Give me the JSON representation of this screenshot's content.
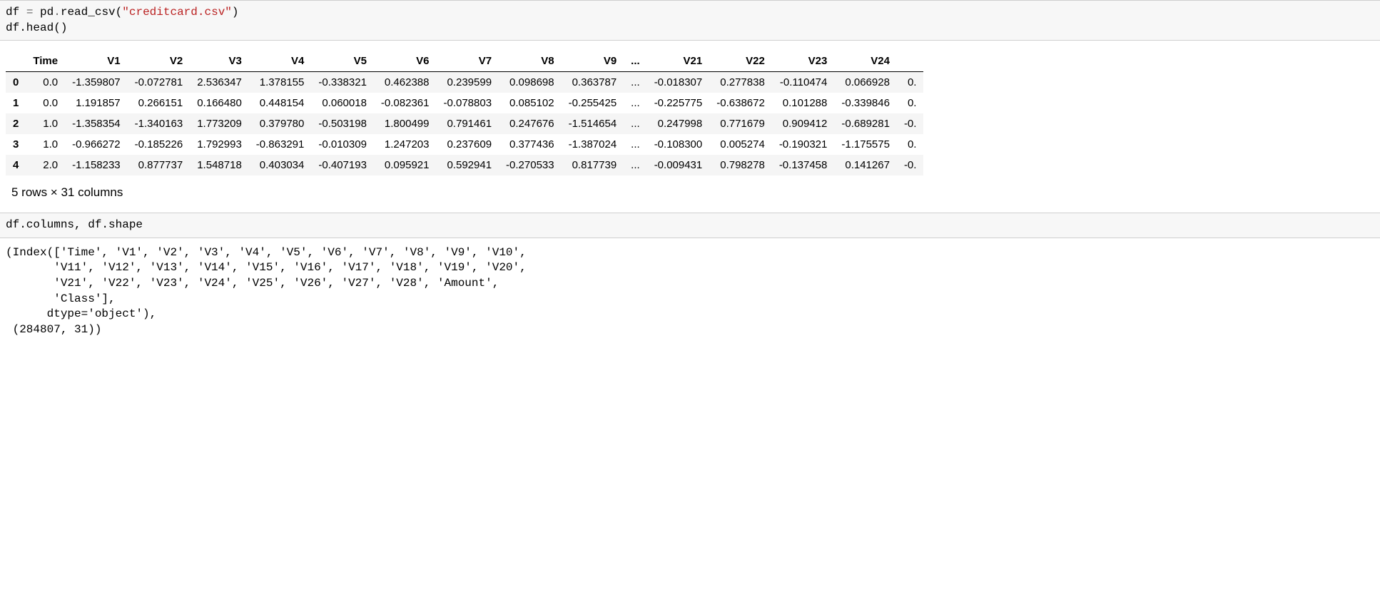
{
  "cell1": {
    "line1_a": "df ",
    "line1_op": "=",
    "line1_b": " pd",
    "line1_dot": ".",
    "line1_c": "read_csv(",
    "line1_str": "\"creditcard.csv\"",
    "line1_d": ")",
    "line2": "df.head()"
  },
  "table": {
    "columns": [
      "Time",
      "V1",
      "V2",
      "V3",
      "V4",
      "V5",
      "V6",
      "V7",
      "V8",
      "V9",
      "...",
      "V21",
      "V22",
      "V23",
      "V24",
      ""
    ],
    "index": [
      "0",
      "1",
      "2",
      "3",
      "4"
    ],
    "rows": [
      [
        "0.0",
        "-1.359807",
        "-0.072781",
        "2.536347",
        "1.378155",
        "-0.338321",
        "0.462388",
        "0.239599",
        "0.098698",
        "0.363787",
        "...",
        "-0.018307",
        "0.277838",
        "-0.110474",
        "0.066928",
        "0."
      ],
      [
        "0.0",
        "1.191857",
        "0.266151",
        "0.166480",
        "0.448154",
        "0.060018",
        "-0.082361",
        "-0.078803",
        "0.085102",
        "-0.255425",
        "...",
        "-0.225775",
        "-0.638672",
        "0.101288",
        "-0.339846",
        "0."
      ],
      [
        "1.0",
        "-1.358354",
        "-1.340163",
        "1.773209",
        "0.379780",
        "-0.503198",
        "1.800499",
        "0.791461",
        "0.247676",
        "-1.514654",
        "...",
        "0.247998",
        "0.771679",
        "0.909412",
        "-0.689281",
        "-0."
      ],
      [
        "1.0",
        "-0.966272",
        "-0.185226",
        "1.792993",
        "-0.863291",
        "-0.010309",
        "1.247203",
        "0.237609",
        "0.377436",
        "-1.387024",
        "...",
        "-0.108300",
        "0.005274",
        "-0.190321",
        "-1.175575",
        "0."
      ],
      [
        "2.0",
        "-1.158233",
        "0.877737",
        "1.548718",
        "0.403034",
        "-0.407193",
        "0.095921",
        "0.592941",
        "-0.270533",
        "0.817739",
        "...",
        "-0.009431",
        "0.798278",
        "-0.137458",
        "0.141267",
        "-0."
      ]
    ],
    "footnote": "5 rows × 31 columns"
  },
  "cell2": {
    "code": "df.columns, df.shape"
  },
  "output2": "(Index(['Time', 'V1', 'V2', 'V3', 'V4', 'V5', 'V6', 'V7', 'V8', 'V9', 'V10',\n       'V11', 'V12', 'V13', 'V14', 'V15', 'V16', 'V17', 'V18', 'V19', 'V20',\n       'V21', 'V22', 'V23', 'V24', 'V25', 'V26', 'V27', 'V28', 'Amount',\n       'Class'],\n      dtype='object'),\n (284807, 31))"
}
